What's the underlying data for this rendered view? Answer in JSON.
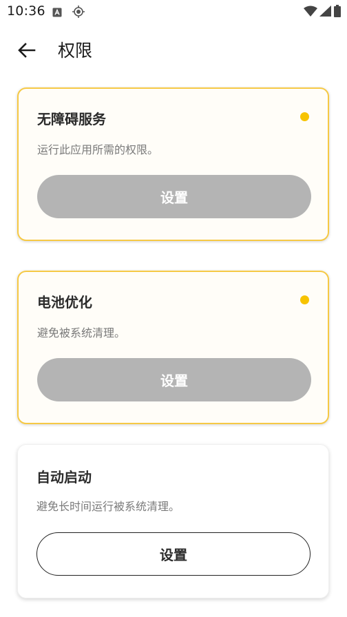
{
  "status_bar": {
    "time": "10:36",
    "icons_left": [
      "a-box-icon",
      "location-crosshair-icon"
    ],
    "icons_right": [
      "wifi-icon",
      "signal-icon",
      "battery-icon"
    ]
  },
  "header": {
    "back_icon": "arrow-left-icon",
    "title": "权限"
  },
  "cards": [
    {
      "title": "无障碍服务",
      "description": "运行此应用所需的权限。",
      "button_label": "设置",
      "status_dot": true,
      "status_color": "#f7c300"
    },
    {
      "title": "电池优化",
      "description": "避免被系统清理。",
      "button_label": "设置",
      "status_dot": true,
      "status_color": "#f7c300"
    },
    {
      "title": "自动启动",
      "description": "避免长时间运行被系统清理。",
      "button_label": "设置",
      "status_dot": false
    }
  ],
  "colors": {
    "accent_border": "#f6c945",
    "accent_dot": "#f7c300",
    "button_disabled": "#b4b4b4"
  }
}
